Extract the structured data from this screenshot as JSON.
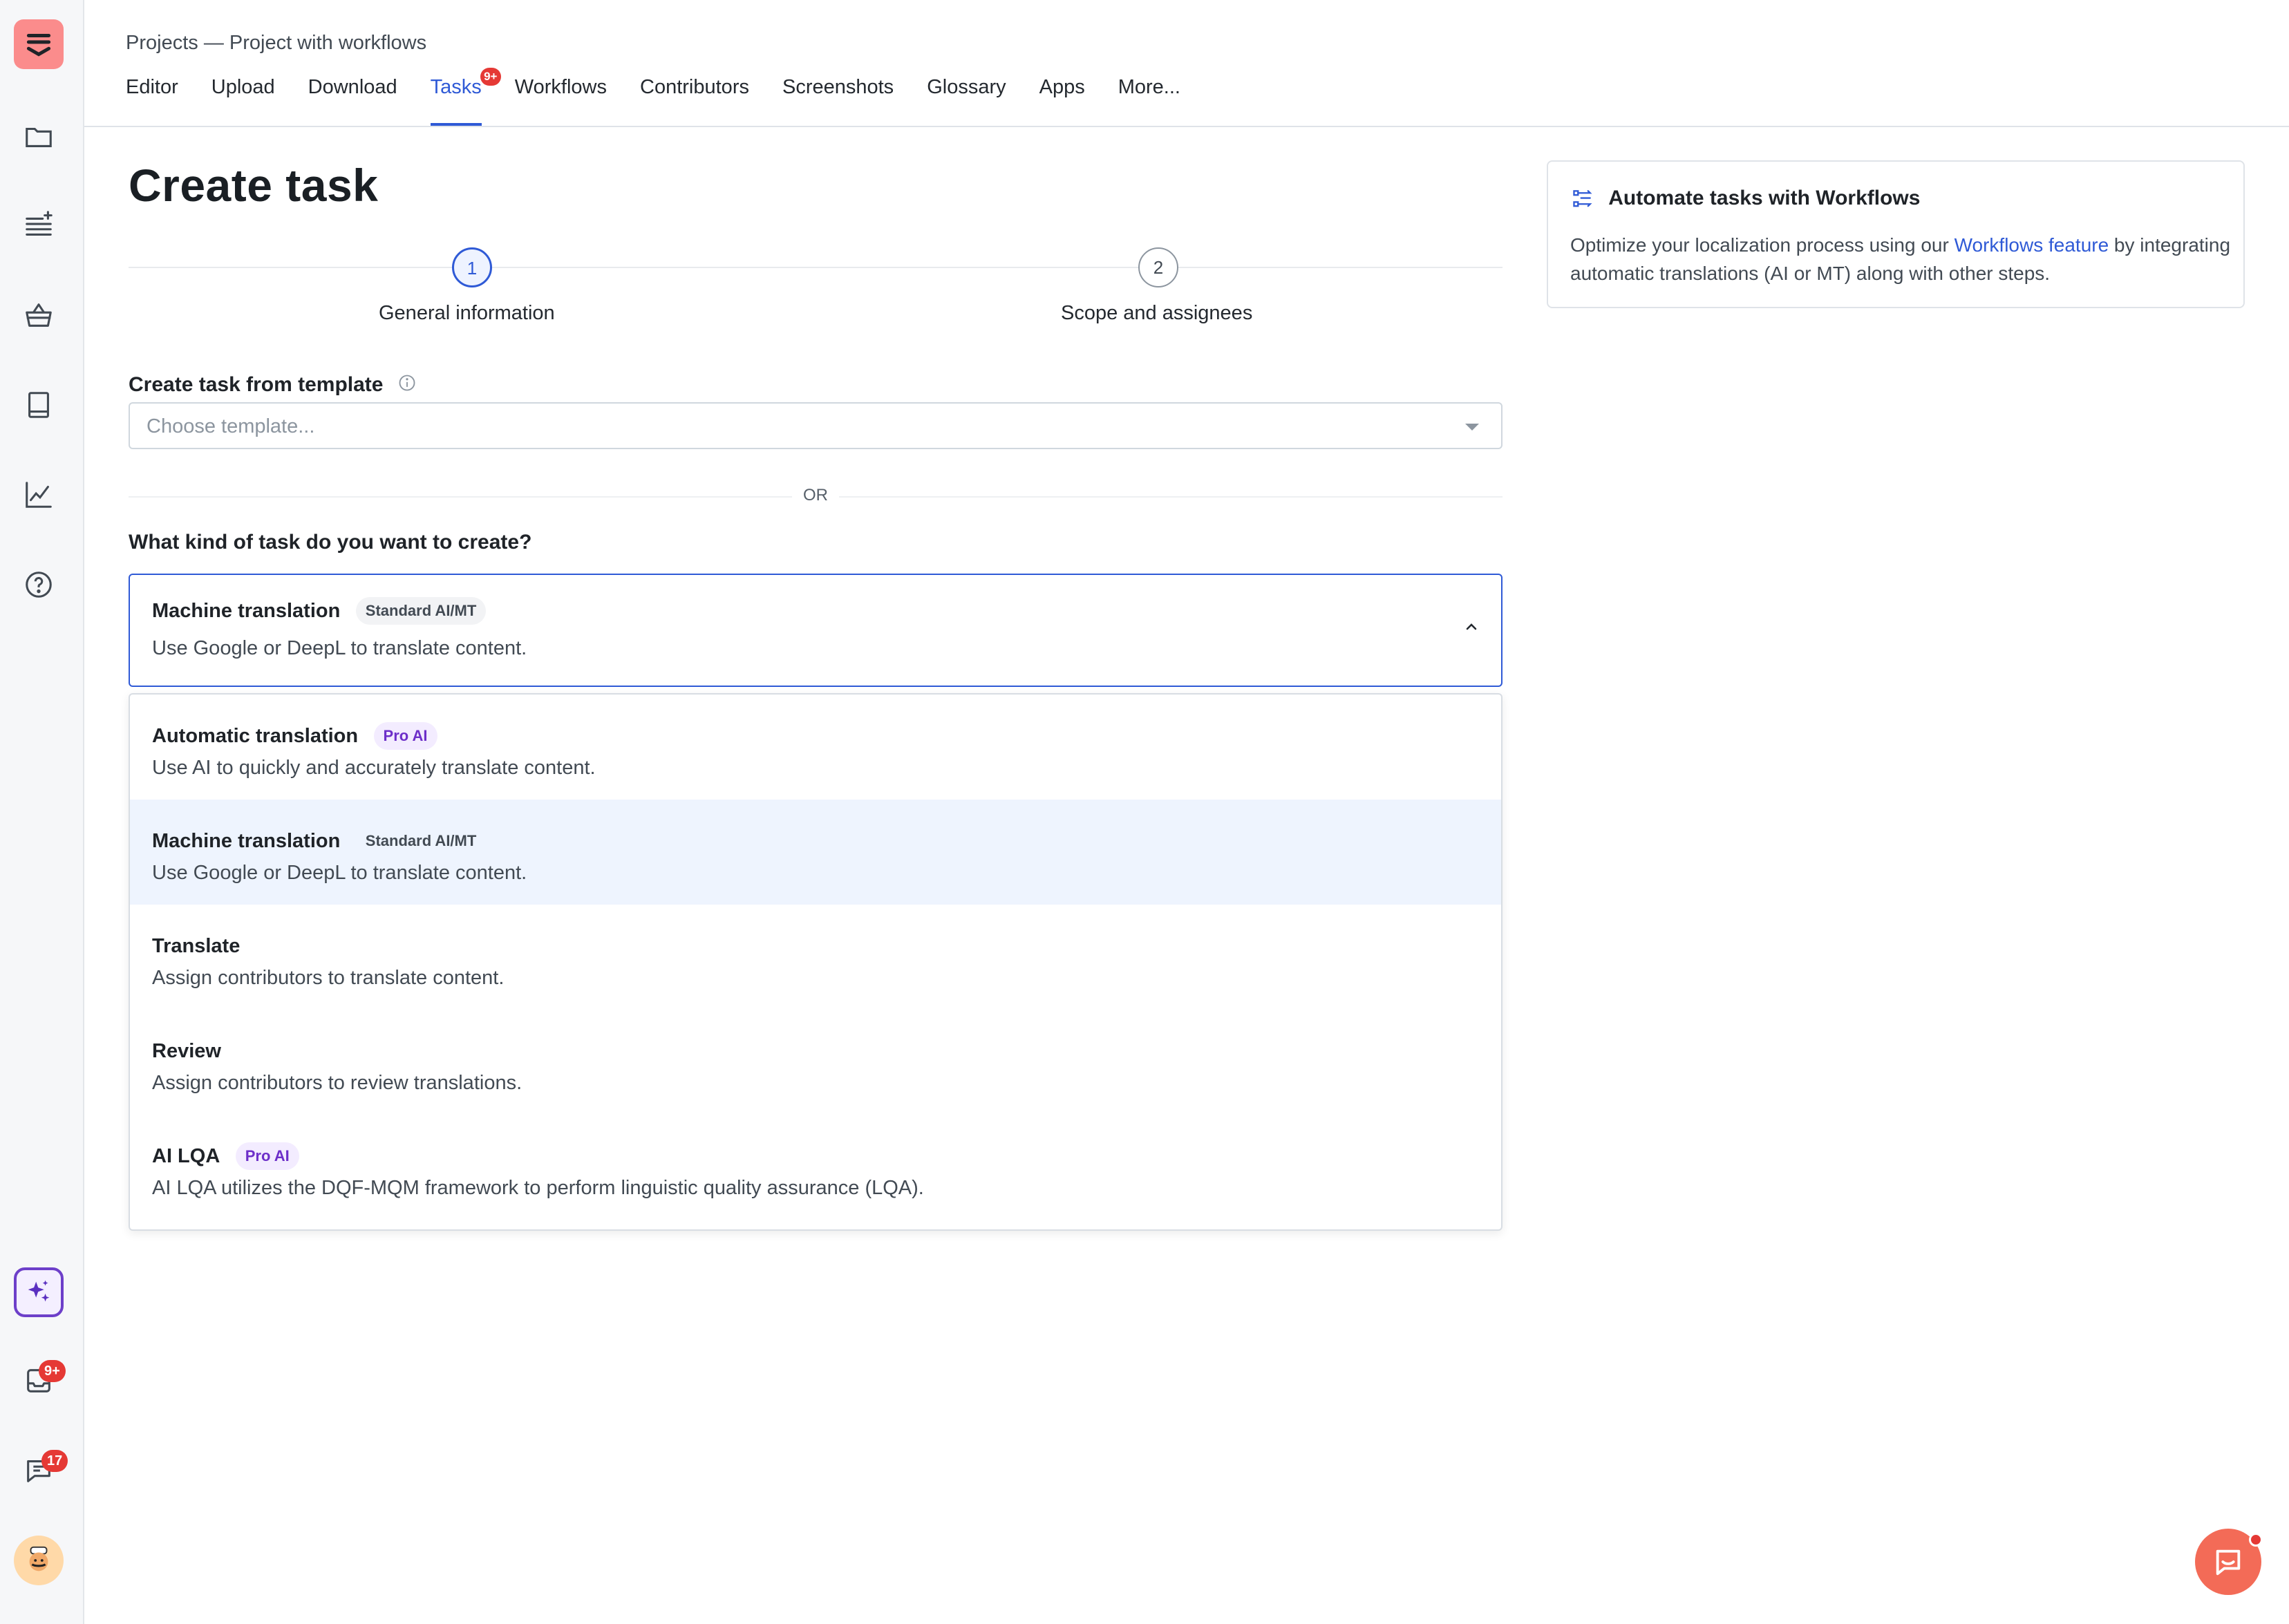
{
  "breadcrumb": "Projects — Project with workflows",
  "tabs": [
    {
      "label": "Editor"
    },
    {
      "label": "Upload"
    },
    {
      "label": "Download"
    },
    {
      "label": "Tasks",
      "badge": "9+"
    },
    {
      "label": "Workflows"
    },
    {
      "label": "Contributors"
    },
    {
      "label": "Screenshots"
    },
    {
      "label": "Glossary"
    },
    {
      "label": "Apps"
    },
    {
      "label": "More..."
    }
  ],
  "sidebar": {
    "icons": [
      "menu-icon",
      "folder-icon",
      "list-sparkle-icon",
      "basket-icon",
      "book-icon",
      "chart-line-icon",
      "help-icon"
    ],
    "bottom": {
      "ai": "sparkles-icon",
      "inbox_badge": "9+",
      "chat_badge": "17"
    }
  },
  "page": {
    "title": "Create task",
    "steps": [
      {
        "number": "1",
        "label": "General information"
      },
      {
        "number": "2",
        "label": "Scope and assignees"
      }
    ],
    "template": {
      "label": "Create task from template",
      "placeholder": "Choose template..."
    },
    "or_text": "OR",
    "task_kind": {
      "label": "What kind of task do you want to create?",
      "selected": {
        "title": "Machine translation",
        "chip": "Standard AI/MT",
        "desc": "Use Google or DeepL to translate content."
      },
      "options": [
        {
          "title": "Automatic translation",
          "chip": "Pro AI",
          "desc": "Use AI to quickly and accurately translate content."
        },
        {
          "title": "Machine translation",
          "chip": "Standard AI/MT",
          "desc": "Use Google or DeepL to translate content."
        },
        {
          "title": "Translate",
          "chip": "",
          "desc": "Assign contributors to translate content."
        },
        {
          "title": "Review",
          "chip": "",
          "desc": "Assign contributors to review translations."
        },
        {
          "title": "AI LQA",
          "chip": "Pro AI",
          "desc": "AI LQA utilizes the DQF-MQM framework to perform linguistic quality assurance (LQA)."
        }
      ]
    }
  },
  "card": {
    "title": "Automate tasks with Workflows",
    "text_before": "Optimize your localization process using our ",
    "link": "Workflows feature",
    "text_after": " by integrating automatic translations (AI or MT) along with other steps."
  },
  "colors": {
    "accent": "#2f5ad6",
    "pro": "#6d2fc9",
    "badge": "#e53935",
    "logo": "#fb8c8c"
  }
}
